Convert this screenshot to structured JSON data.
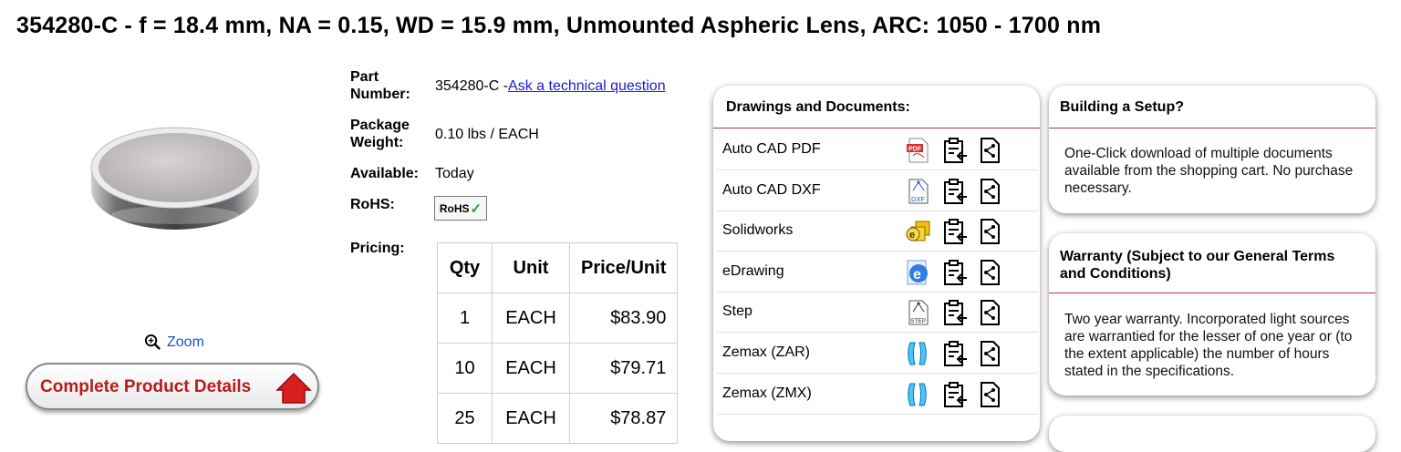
{
  "title": "354280-C - f = 18.4 mm, NA = 0.15, WD = 15.9 mm, Unmounted Aspheric Lens, ARC: 1050 - 1700 nm",
  "image": {
    "zoom_label": "Zoom",
    "details_button": "Complete Product Details"
  },
  "specs": {
    "part_number_label_1": "Part",
    "part_number_label_2": "Number:",
    "part_number_value": "354280-C -",
    "ask_link": "Ask a technical question",
    "weight_label_1": "Package",
    "weight_label_2": "Weight:",
    "weight_value": "0.10 lbs / EACH",
    "available_label": "Available:",
    "available_value": "Today",
    "rohs_label": "RoHS:",
    "rohs_badge": "RoHS",
    "pricing_label": "Pricing:"
  },
  "pricing": {
    "headers": [
      "Qty",
      "Unit",
      "Price/Unit"
    ],
    "rows": [
      {
        "qty": "1",
        "unit": "EACH",
        "price": "$83.90"
      },
      {
        "qty": "10",
        "unit": "EACH",
        "price": "$79.71"
      },
      {
        "qty": "25",
        "unit": "EACH",
        "price": "$78.87"
      }
    ]
  },
  "docs": {
    "title": "Drawings and Documents:",
    "rows": [
      {
        "name": "Auto CAD PDF",
        "icon": "pdf-icon"
      },
      {
        "name": "Auto CAD DXF",
        "icon": "dxf-icon"
      },
      {
        "name": "Solidworks",
        "icon": "solidworks-icon"
      },
      {
        "name": "eDrawing",
        "icon": "edrawing-icon"
      },
      {
        "name": "Step",
        "icon": "step-icon"
      },
      {
        "name": "Zemax (ZAR)",
        "icon": "zemax-lens-icon"
      },
      {
        "name": "Zemax (ZMX)",
        "icon": "zemax-lens-icon"
      }
    ]
  },
  "setup": {
    "title": "Building a Setup?",
    "body": "One-Click download of multiple documents available from the shopping cart. No purchase necessary."
  },
  "warranty": {
    "title": "Warranty (Subject to our General Terms and Conditions)",
    "body": "Two year warranty. Incorporated light sources are warrantied for the lesser of one year or (to the extent applicable) the number of hours stated in the specifications."
  }
}
